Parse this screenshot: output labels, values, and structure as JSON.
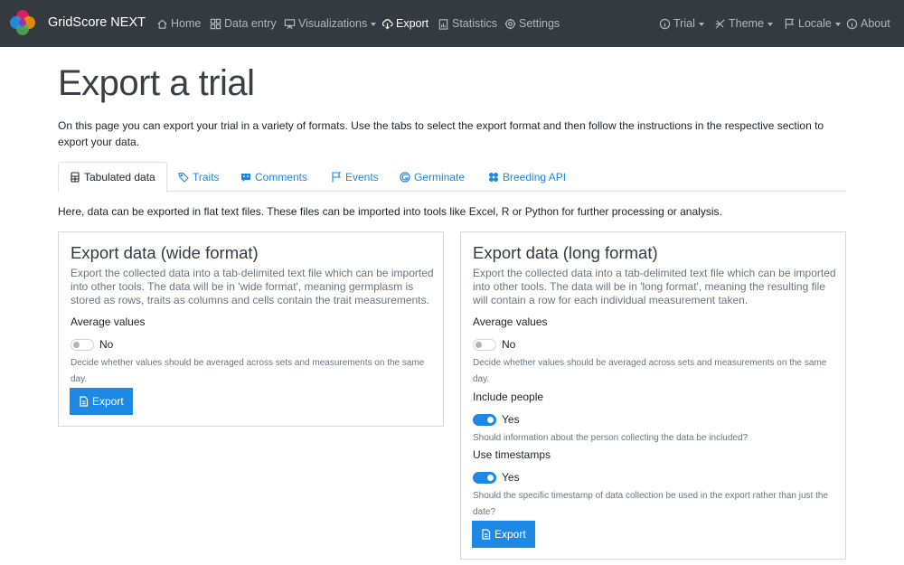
{
  "app": {
    "brand": "GridScore NEXT"
  },
  "nav": {
    "home": "Home",
    "data_entry": "Data entry",
    "visualizations": "Visualizations",
    "export": "Export",
    "statistics": "Statistics",
    "settings": "Settings",
    "trial": "Trial",
    "theme": "Theme",
    "locale": "Locale",
    "about": "About"
  },
  "page": {
    "title": "Export a trial",
    "intro": "On this page you can export your trial in a variety of formats. Use the tabs to select the export format and then follow the instructions in the respective section to export your data."
  },
  "tabs": [
    {
      "label": "Tabulated data",
      "icon": "table-icon",
      "active": true
    },
    {
      "label": "Traits",
      "icon": "tags-icon",
      "active": false
    },
    {
      "label": "Comments",
      "icon": "comment-icon",
      "active": false
    },
    {
      "label": "Events",
      "icon": "flag-icon",
      "active": false
    },
    {
      "label": "Germinate",
      "icon": "germinate-icon",
      "active": false
    },
    {
      "label": "Breeding API",
      "icon": "brapi-icon",
      "active": false
    }
  ],
  "tab_description": "Here, data can be exported in flat text files. These files can be imported into tools like Excel, R or Python for further processing or analysis.",
  "wide": {
    "title": "Export data (wide format)",
    "text": "Export the collected data into a tab-delimited text file which can be imported into other tools. The data will be in 'wide format', meaning germplasm is stored as rows, traits as columns and cells contain the trait measurements.",
    "average_label": "Average values",
    "average_value": "No",
    "average_help": "Decide whether values should be averaged across sets and measurements on the same day.",
    "button": "Export"
  },
  "long": {
    "title": "Export data (long format)",
    "text": "Export the collected data into a tab-delimited text file which can be imported into other tools. The data will be in 'long format', meaning the resulting file will contain a row for each individual measurement taken.",
    "average_label": "Average values",
    "average_value": "No",
    "average_help": "Decide whether values should be averaged across sets and measurements on the same day.",
    "people_label": "Include people",
    "people_value": "Yes",
    "people_help": "Should information about the person collecting the data be included?",
    "timestamps_label": "Use timestamps",
    "timestamps_value": "Yes",
    "timestamps_help": "Should the specific timestamp of data collection be used in the export rather than just the date?",
    "button": "Export"
  },
  "colors": {
    "navbar": "#343a40",
    "accent": "#1e88e5"
  }
}
